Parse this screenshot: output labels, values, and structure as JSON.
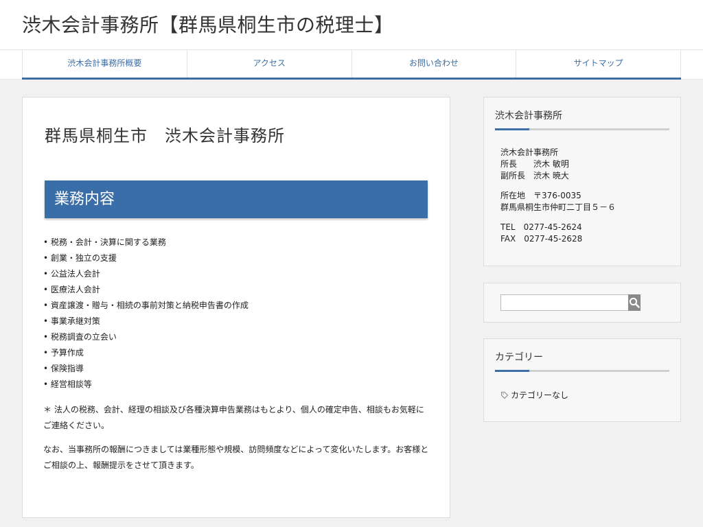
{
  "header": {
    "site_title": "渋木会計事務所【群馬県桐生市の税理士】"
  },
  "nav": {
    "items": [
      {
        "label": "渋木会計事務所概要"
      },
      {
        "label": "アクセス"
      },
      {
        "label": "お問い合わせ"
      },
      {
        "label": "サイトマップ"
      }
    ]
  },
  "main": {
    "page_title": "群馬県桐生市　渋木会計事務所",
    "section_heading": "業務内容",
    "services": [
      "• 税務・会計・決算に関する業務",
      "• 創業・独立の支援",
      "• 公益法人会計",
      "• 医療法人会計",
      "• 資産譲渡・贈与・相続の事前対策と納税申告書の作成",
      "• 事業承継対策",
      "• 税務調査の立会い",
      "• 予算作成",
      "• 保険指導",
      "• 経営相談等"
    ],
    "note1": "＊ 法人の税務、会計、経理の相談及び各種決算申告業務はもとより、個人の確定申告、相談もお気軽にご連絡ください。",
    "note2": "なお、当事務所の報酬につきましては業種形態や規模、訪問頻度などによって変化いたします。お客様とご相談の上、報酬提示をさせて頂きます。"
  },
  "sidebar": {
    "info_widget": {
      "title": "渋木会計事務所",
      "office_name": "渋木会計事務所",
      "director": "所長　　渋木 敏明",
      "vice_director": "副所長　渋木 暁大",
      "postal": "所在地　〒376-0035",
      "address": "群馬県桐生市仲町二丁目５－６",
      "tel": "TEL　0277-45-2624",
      "fax": "FAX　0277-45-2628"
    },
    "search_widget": {
      "value": "",
      "icon": "search-icon"
    },
    "category_widget": {
      "title": "カテゴリー",
      "empty_label": "カテゴリーなし",
      "icon": "tag-icon"
    }
  },
  "colors": {
    "accent": "#3b6ea5",
    "heading_bg": "#3a6ea8",
    "search_button": "#8a8a8a"
  }
}
